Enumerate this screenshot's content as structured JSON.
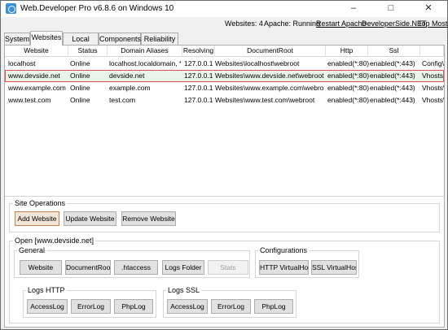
{
  "window": {
    "title": "Web.Developer Pro v6.8.6 on Windows 10",
    "minimize": "–",
    "maximize": "□",
    "close": "✕"
  },
  "statusbar": {
    "websites": "Websites: 4",
    "apache": "Apache: Running",
    "restart": "Restart Apache",
    "devsite": "DeveloperSide.NET",
    "topmost": "Top Most"
  },
  "tabs": [
    "System",
    "Websites",
    "Local DNS",
    "Components",
    "Reliability"
  ],
  "grid": {
    "columns": [
      "Website",
      "Status",
      "Domain Aliases",
      "Resolving",
      "DocumentRoot",
      "Http",
      "Ssl",
      ""
    ],
    "rows": [
      [
        "localhost",
        "Online",
        "localhost.localdomain, *",
        "127.0.0.1",
        "Websites\\localhost\\webroot",
        "enabled(*:80)",
        "enabled(*:443)",
        "Config\\v"
      ],
      [
        "www.devside.net",
        "Online",
        "devside.net",
        "127.0.0.1",
        "Websites\\www.devside.net\\webroot",
        "enabled(*:80)",
        "enabled(*:443)",
        "Vhosts\\w"
      ],
      [
        "www.example.com",
        "Online",
        "example.com",
        "127.0.0.1",
        "Websites\\www.example.com\\webroot",
        "enabled(*:80)",
        "enabled(*:443)",
        "Vhosts\\w"
      ],
      [
        "www.test.com",
        "Online",
        "test.com",
        "127.0.0.1",
        "Websites\\www.test.com\\webroot",
        "enabled(*:80)",
        "enabled(*:443)",
        "Vhosts\\w"
      ]
    ]
  },
  "site_ops": {
    "label": "Site Operations",
    "add": "Add Website",
    "update": "Update Website",
    "remove": "Remove Website"
  },
  "open": {
    "label": "Open [www.devside.net]",
    "general": {
      "label": "General",
      "website": "Website",
      "docroot": "DocumentRoot",
      "htaccess": ".htaccess",
      "logs": "Logs Folder",
      "stats": "Stats"
    },
    "config": {
      "label": "Configurations",
      "http": "HTTP VirtualHost",
      "ssl": "SSL VirtualHost"
    },
    "logs_http": {
      "label": "Logs HTTP",
      "access": "AccessLog",
      "error": "ErrorLog",
      "php": "PhpLog"
    },
    "logs_ssl": {
      "label": "Logs SSL",
      "access": "AccessLog",
      "error": "ErrorLog",
      "php": "PhpLog"
    }
  }
}
